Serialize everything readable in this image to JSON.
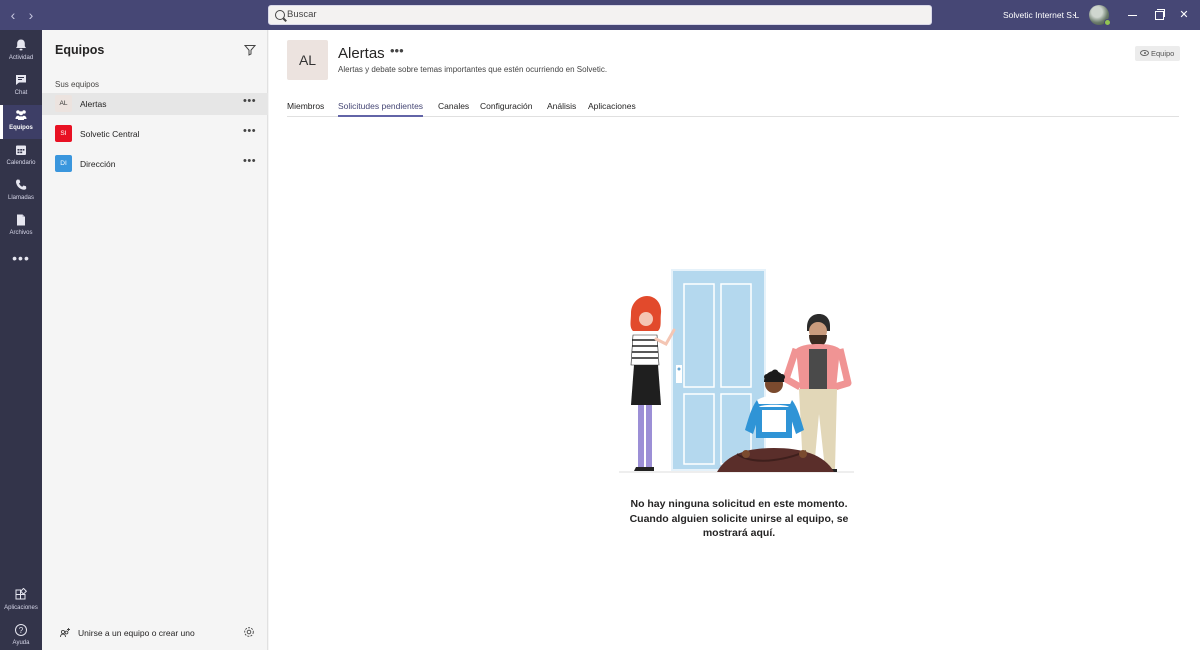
{
  "titlebar": {
    "search_placeholder": "Buscar",
    "org_name": "Solvetic Internet S.L"
  },
  "rail": {
    "items": [
      {
        "label": "Actividad",
        "icon": "bell-icon"
      },
      {
        "label": "Chat",
        "icon": "chat-icon"
      },
      {
        "label": "Equipos",
        "icon": "teams-icon",
        "active": true
      },
      {
        "label": "Calendario",
        "icon": "calendar-icon"
      },
      {
        "label": "Llamadas",
        "icon": "phone-icon"
      },
      {
        "label": "Archivos",
        "icon": "file-icon"
      }
    ],
    "more": "•••",
    "apps_label": "Aplicaciones",
    "help_label": "Ayuda"
  },
  "panel": {
    "title": "Equipos",
    "section_label": "Sus equipos",
    "teams": [
      {
        "initials": "AL",
        "name": "Alertas",
        "color": "#ece3df",
        "text_color": "#333333",
        "active": true
      },
      {
        "initials": "SI",
        "name": "Solvetic Central",
        "color": "#e81123",
        "text_color": "#ffffff"
      },
      {
        "initials": "DI",
        "name": "Dirección",
        "color": "#3a96dd",
        "text_color": "#ffffff"
      }
    ],
    "more": "•••",
    "join_text": "Unirse a un equipo o crear uno"
  },
  "main": {
    "team_initials": "AL",
    "team_title": "Alertas",
    "title_more": "•••",
    "team_description": "Alertas y debate sobre temas importantes que estén ocurriendo en Solvetic.",
    "team_button": "Equipo",
    "tabs": [
      "Miembros",
      "Solicitudes pendientes",
      "Canales",
      "Configuración",
      "Análisis",
      "Aplicaciones"
    ],
    "active_tab": "Solicitudes pendientes",
    "empty_line1": "No hay ninguna solicitud en este momento.",
    "empty_line2": "Cuando alguien solicite unirse al equipo, se",
    "empty_line3": "mostrará aquí."
  },
  "colors": {
    "titlebar": "#464775",
    "rail": "#33344a",
    "accent": "#6264a7",
    "status_available": "#92c353"
  }
}
